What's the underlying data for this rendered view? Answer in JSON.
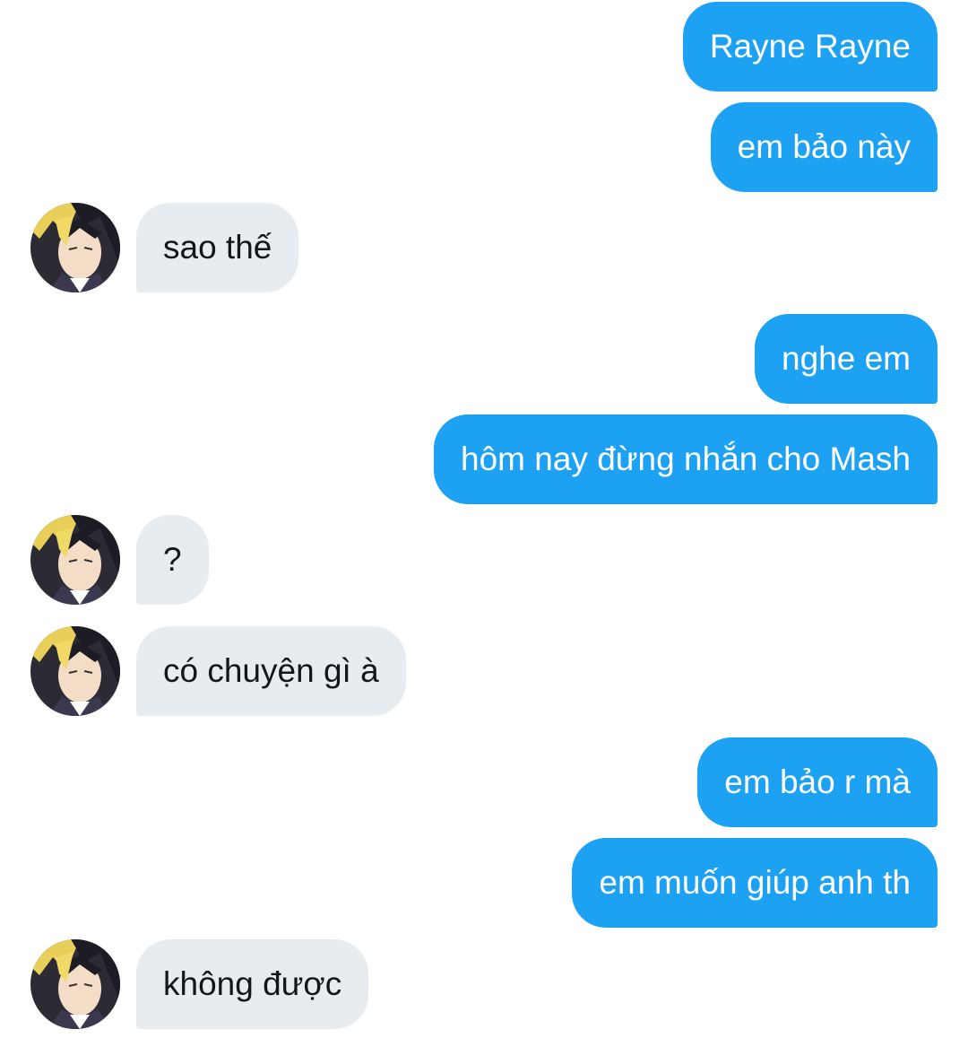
{
  "conversation": {
    "messages": [
      {
        "side": "out",
        "text": "Rayne Rayne"
      },
      {
        "side": "out",
        "text": "em bảo này"
      },
      {
        "side": "in",
        "text": "sao thế"
      },
      {
        "side": "out",
        "text": "nghe em"
      },
      {
        "side": "out",
        "text": "hôm nay đừng nhắn cho Mash"
      },
      {
        "side": "in",
        "text": "?"
      },
      {
        "side": "in",
        "text": "có chuyện gì à"
      },
      {
        "side": "out",
        "text": "em bảo r mà"
      },
      {
        "side": "out",
        "text": "em muốn giúp anh th"
      },
      {
        "side": "in",
        "text": "không được"
      }
    ]
  },
  "colors": {
    "outgoing_bubble": "#1da1f2",
    "outgoing_text": "#ffffff",
    "incoming_bubble": "#e6ecf0",
    "incoming_text": "#14171a",
    "background": "#ffffff"
  },
  "icons": {
    "avatar": "anime-character-avatar-icon"
  }
}
